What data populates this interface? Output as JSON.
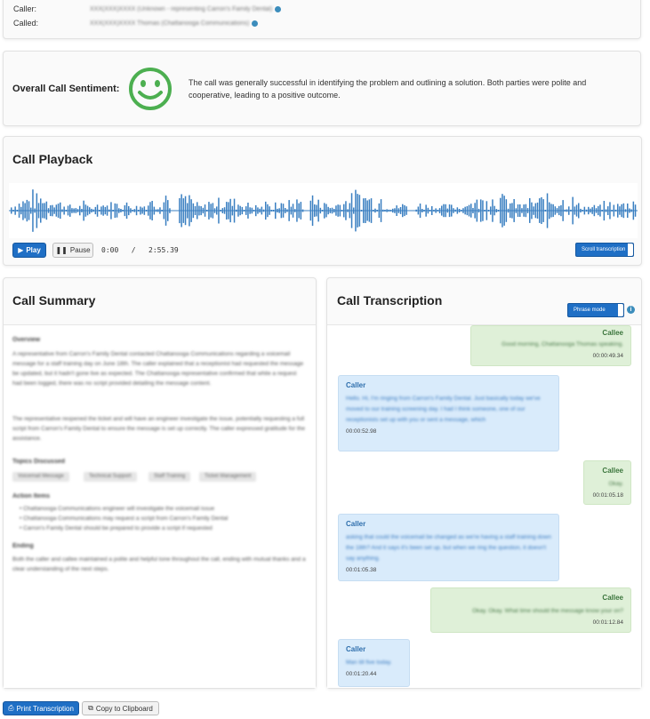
{
  "call_info": {
    "caller_label": "Caller:",
    "caller_value": "XXX(XXX)XXXX (Unknown - representing Carron's Family Dental)",
    "called_label": "Called:",
    "called_value": "XXX(XXX)XXXX Thomas (Chattanooga Communications)"
  },
  "sentiment": {
    "label": "Overall Call Sentiment:",
    "icon": "smiley-face-icon",
    "color": "#4caf50",
    "text": "The call was generally successful in identifying the problem and outlining a solution. Both parties were polite and cooperative, leading to a positive outcome."
  },
  "playback": {
    "title": "Call Playback",
    "play_label": "Play",
    "pause_label": "Pause",
    "current_time": "0:00",
    "separator": "/",
    "duration": "2:55.39",
    "scroll_toggle_label": "Scroll transcription",
    "waveform_color": "#3a7fc1"
  },
  "summary": {
    "title": "Call Summary",
    "overview_heading": "Overview",
    "overview_p1": "A representative from Carron's Family Dental contacted Chattanooga Communications regarding a voicemail message for a staff training day on June 18th. The caller explained that a receptionist had requested the message be updated, but it hadn't gone live as expected. The Chattanooga representative confirmed that while a request had been logged, there was no script provided detailing the message content.",
    "overview_p2": "The representative reopened the ticket and will have an engineer investigate the issue, potentially requesting a full script from Carron's Family Dental to ensure the message is set up correctly. The caller expressed gratitude for the assistance.",
    "topics_heading": "Topics Discussed",
    "topics": [
      "Voicemail Message",
      "Technical Support",
      "Staff Training",
      "Ticket Management"
    ],
    "actions_heading": "Action Items",
    "actions": [
      "Chattanooga Communications engineer will investigate the voicemail issue",
      "Chattanooga Communications may request a script from Carron's Family Dental",
      "Carron's Family Dental should be prepared to provide a script if requested"
    ],
    "ending_heading": "Ending",
    "ending_text": "Both the caller and callee maintained a polite and helpful tone throughout the call, ending with mutual thanks and a clear understanding of the next steps."
  },
  "transcription": {
    "title": "Call Transcription",
    "phrase_toggle_label": "Phrase mode",
    "messages": [
      {
        "speaker": "Callee",
        "text": "Good morning, Chattanooga Thomas speaking.",
        "time": "00:00:49.34"
      },
      {
        "speaker": "Caller",
        "text": "Hello. Hi, I'm ringing from Carron's Family Dental. Just basically today we've moved to our training screening day. I had I think someone, one of our receptionists set up with you or sent a message, which",
        "time": "00:00:52.98"
      },
      {
        "speaker": "Callee",
        "text": "Okay.",
        "time": "00:01:05.18"
      },
      {
        "speaker": "Caller",
        "text": "asking that could the voicemail be changed as we're having a staff training down the 18th? And it says it's been set up, but when we ring the question, it doesn't say anything.",
        "time": "00:01:05.38"
      },
      {
        "speaker": "Callee",
        "text": "Okay. Okay. What time should the message know your on?",
        "time": "00:01:12.84"
      },
      {
        "speaker": "Caller",
        "text": "Man till five today.",
        "time": "00:01:20.44"
      }
    ]
  },
  "footer": {
    "print_label": "Print Transcription",
    "copy_label": "Copy to Clipboard"
  }
}
